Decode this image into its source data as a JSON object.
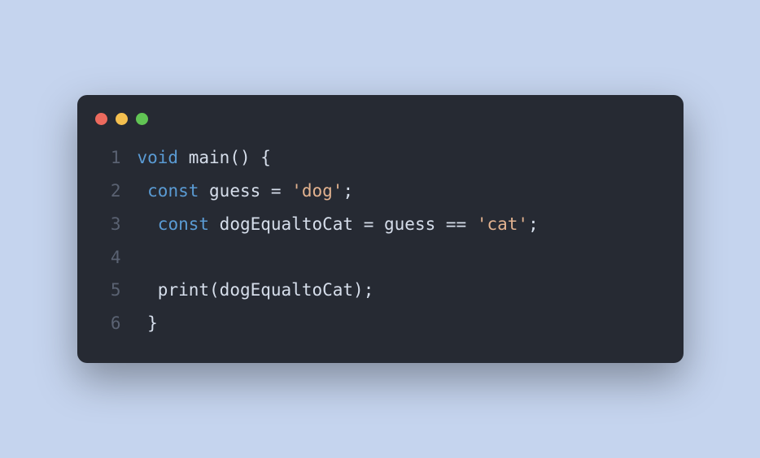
{
  "window": {
    "traffic_lights": {
      "red": "#ec6a5e",
      "yellow": "#f4bf4f",
      "green": "#61c454"
    }
  },
  "code": {
    "lines": [
      {
        "n": "1",
        "tokens": [
          {
            "t": "void",
            "c": "keyword"
          },
          {
            "t": " ",
            "c": "space"
          },
          {
            "t": "main",
            "c": "funcname"
          },
          {
            "t": "() {",
            "c": "punct"
          }
        ]
      },
      {
        "n": "2",
        "tokens": [
          {
            "t": " ",
            "c": "space"
          },
          {
            "t": "const",
            "c": "keyword"
          },
          {
            "t": " ",
            "c": "space"
          },
          {
            "t": "guess",
            "c": "ident"
          },
          {
            "t": " ",
            "c": "space"
          },
          {
            "t": "=",
            "c": "operator"
          },
          {
            "t": " ",
            "c": "space"
          },
          {
            "t": "'dog'",
            "c": "string"
          },
          {
            "t": ";",
            "c": "punct"
          }
        ]
      },
      {
        "n": "3",
        "tokens": [
          {
            "t": "  ",
            "c": "space"
          },
          {
            "t": "const",
            "c": "keyword"
          },
          {
            "t": " ",
            "c": "space"
          },
          {
            "t": "dogEqualtoCat",
            "c": "ident"
          },
          {
            "t": " ",
            "c": "space"
          },
          {
            "t": "=",
            "c": "operator"
          },
          {
            "t": " ",
            "c": "space"
          },
          {
            "t": "guess",
            "c": "ident"
          },
          {
            "t": " ",
            "c": "space"
          },
          {
            "t": "==",
            "c": "operator"
          },
          {
            "t": " ",
            "c": "space"
          },
          {
            "t": "'cat'",
            "c": "string"
          },
          {
            "t": ";",
            "c": "punct"
          }
        ]
      },
      {
        "n": "4",
        "tokens": []
      },
      {
        "n": "5",
        "tokens": [
          {
            "t": "  ",
            "c": "space"
          },
          {
            "t": "print",
            "c": "funcname"
          },
          {
            "t": "(",
            "c": "punct"
          },
          {
            "t": "dogEqualtoCat",
            "c": "ident"
          },
          {
            "t": ");",
            "c": "punct"
          }
        ]
      },
      {
        "n": "6",
        "tokens": [
          {
            "t": " ",
            "c": "space"
          },
          {
            "t": "}",
            "c": "punct"
          }
        ]
      }
    ]
  }
}
